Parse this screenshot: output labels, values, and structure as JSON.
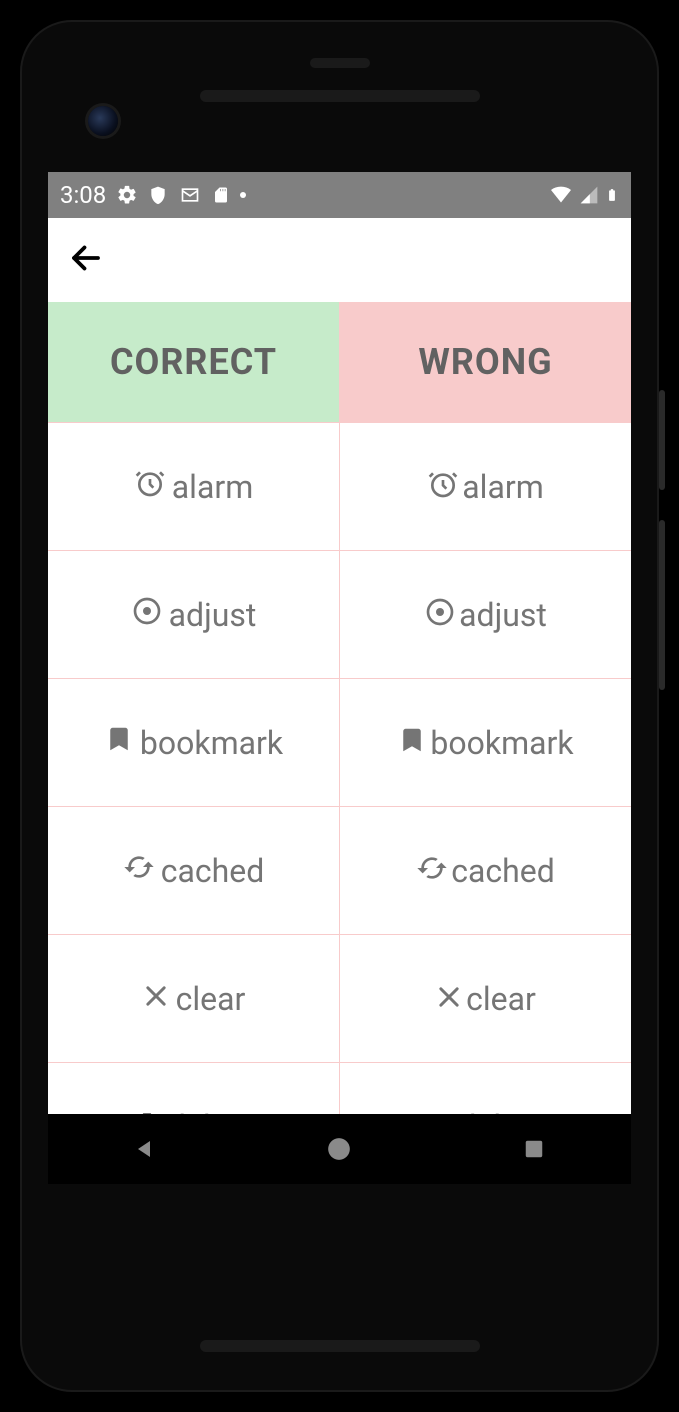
{
  "statusbar": {
    "time": "3:08"
  },
  "table": {
    "headers": {
      "correct": "CORRECT",
      "wrong": "WRONG"
    },
    "rows": [
      {
        "icon": "alarm",
        "label": "alarm"
      },
      {
        "icon": "adjust",
        "label": "adjust"
      },
      {
        "icon": "bookmark",
        "label": "bookmark"
      },
      {
        "icon": "cached",
        "label": "cached"
      },
      {
        "icon": "clear",
        "label": "clear"
      },
      {
        "icon": "delete",
        "label": "delete"
      }
    ]
  }
}
